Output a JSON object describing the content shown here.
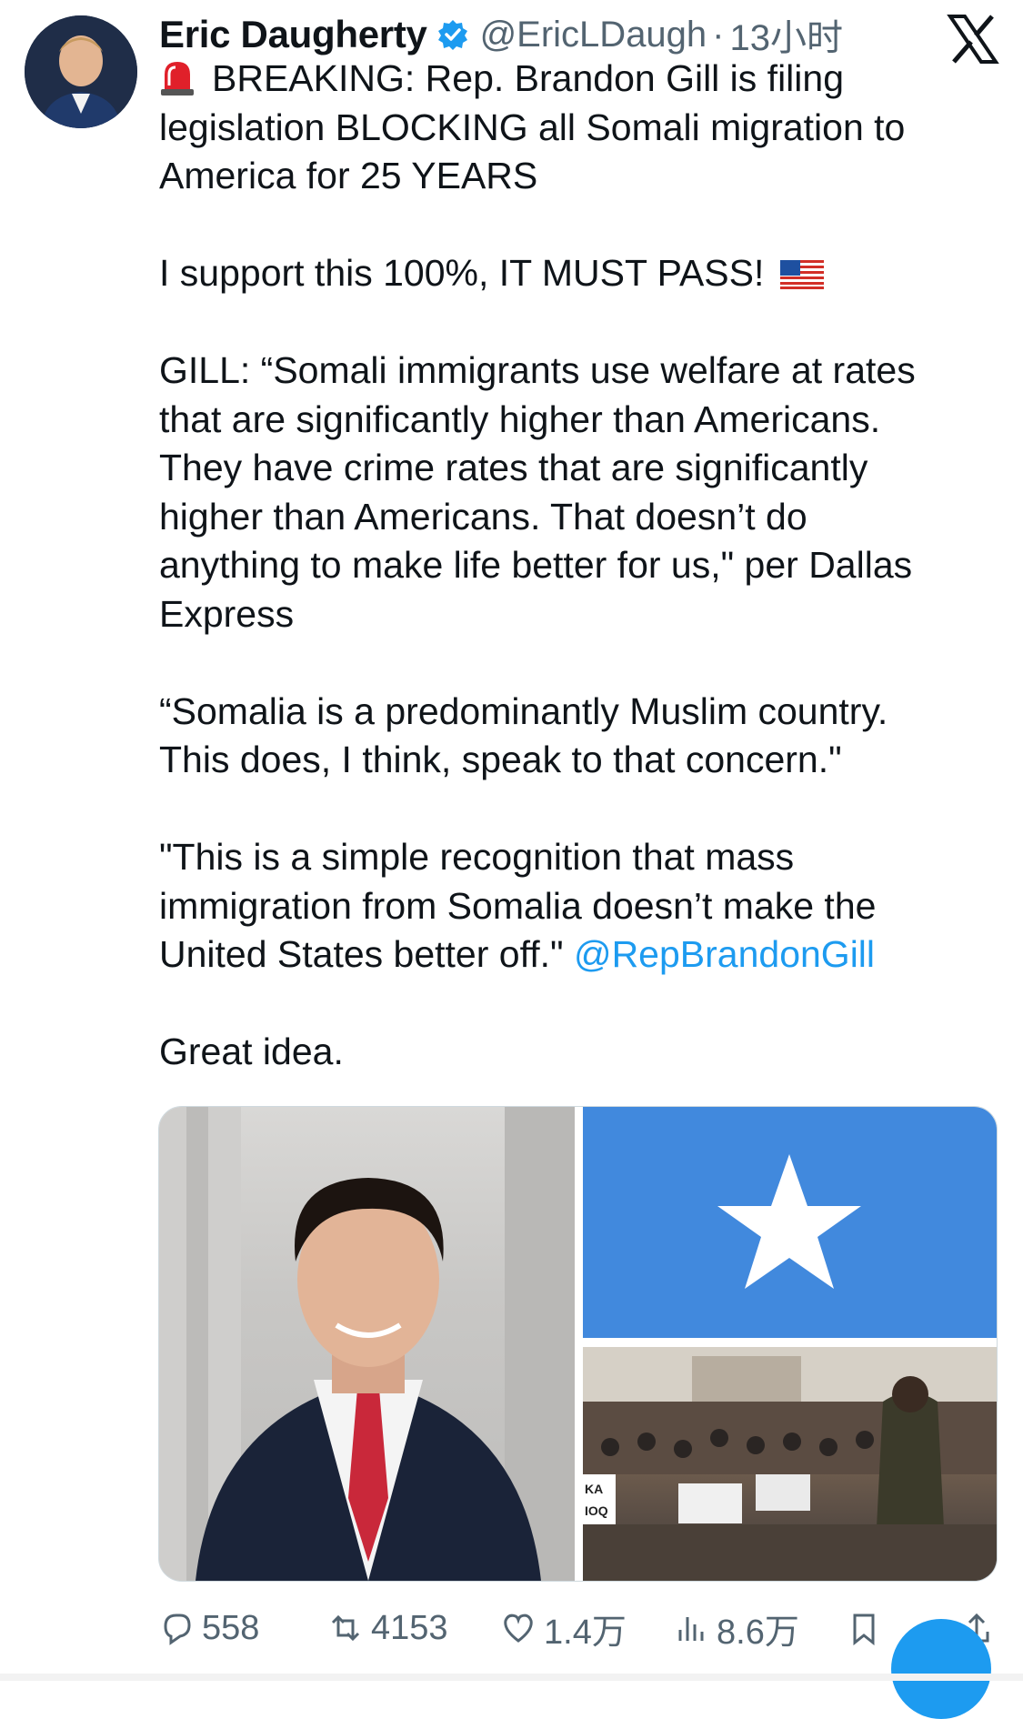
{
  "author": {
    "name": "Eric Daugherty",
    "handle": "@EricLDaugh",
    "separator": "·",
    "time": "13小时"
  },
  "tweet": {
    "line_breaking": "BREAKING: Rep. Brandon Gill is filing\nlegislation BLOCKING all Somali migration to\nAmerica for 25 YEARS\n\n",
    "support": "I support this 100%, IT MUST PASS!",
    "quote_block": "\n\nGILL: “Somali immigrants use welfare at rates\nthat are significantly higher than Americans.\nThey have crime rates that are significantly\nhigher than Americans. That doesn’t do\nanything to make life better for us,\" per Dallas\nExpress\n\n“Somalia is a predominantly Muslim country.\nThis does, I think, speak to that concern.\"\n\n\"This is a simple recognition that mass\nimmigration from Somalia doesn’t make the\nUnited States better off.\" ",
    "mention": "@RepBrandonGill",
    "closing": "\n\nGreat idea."
  },
  "crowd_sign_text": "KA\nIOQ",
  "actions": {
    "replies": "558",
    "retweets": "4153",
    "likes": "1.4万",
    "views": "8.6万"
  },
  "icons": {
    "verified": "verified-badge-icon",
    "close": "x-logo-icon",
    "siren": "siren-emoji-icon",
    "flag": "us-flag-emoji-icon",
    "reply": "reply-icon",
    "retweet": "retweet-icon",
    "like": "heart-icon",
    "views": "views-icon",
    "bookmark": "bookmark-icon",
    "share": "share-icon"
  },
  "colors": {
    "accent": "#1d9bf0",
    "secondary_text": "#536471",
    "somali_flag_blue": "#4189dd"
  }
}
